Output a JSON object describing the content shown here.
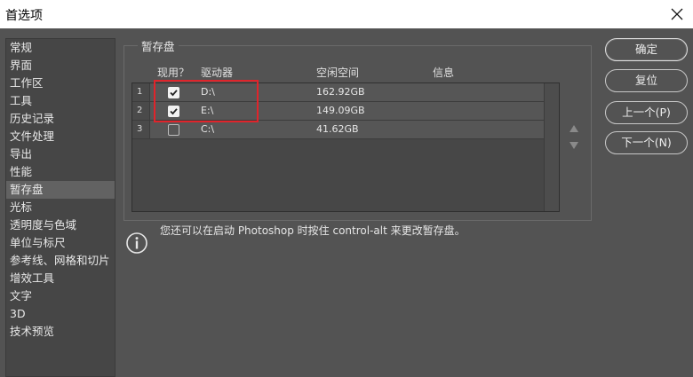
{
  "window": {
    "title": "首选项"
  },
  "sidebar": {
    "items": [
      {
        "label": "常规"
      },
      {
        "label": "界面"
      },
      {
        "label": "工作区"
      },
      {
        "label": "工具"
      },
      {
        "label": "历史记录"
      },
      {
        "label": "文件处理"
      },
      {
        "label": "导出"
      },
      {
        "label": "性能"
      },
      {
        "label": "暂存盘",
        "selected": true
      },
      {
        "label": "光标"
      },
      {
        "label": "透明度与色域"
      },
      {
        "label": "单位与标尺"
      },
      {
        "label": "参考线、网格和切片"
      },
      {
        "label": "增效工具"
      },
      {
        "label": "文字"
      },
      {
        "label": "3D"
      },
      {
        "label": "技术预览"
      }
    ]
  },
  "scratch": {
    "legend": "暂存盘",
    "headers": {
      "active": "现用？",
      "drive": "驱动器",
      "free": "空闲空间",
      "info": "信息"
    },
    "rows": [
      {
        "num": "1",
        "checked": true,
        "drive": "D:\\",
        "free": "162.92GB",
        "info": ""
      },
      {
        "num": "2",
        "checked": true,
        "drive": "E:\\",
        "free": "149.09GB",
        "info": ""
      },
      {
        "num": "3",
        "checked": false,
        "drive": "C:\\",
        "free": "41.62GB",
        "info": ""
      }
    ],
    "info_text": "您还可以在启动 Photoshop 时按住 control-alt 来更改暂存盘。"
  },
  "buttons": {
    "ok": "确定",
    "reset": "复位",
    "prev": "上一个(P)",
    "next": "下一个(N)"
  },
  "icons": {
    "close": "close-icon",
    "info": "info-icon",
    "check": "check-icon",
    "up": "arrow-up-icon",
    "down": "arrow-down-icon"
  },
  "colors": {
    "highlight": "#e0242b",
    "background": "#535353"
  }
}
